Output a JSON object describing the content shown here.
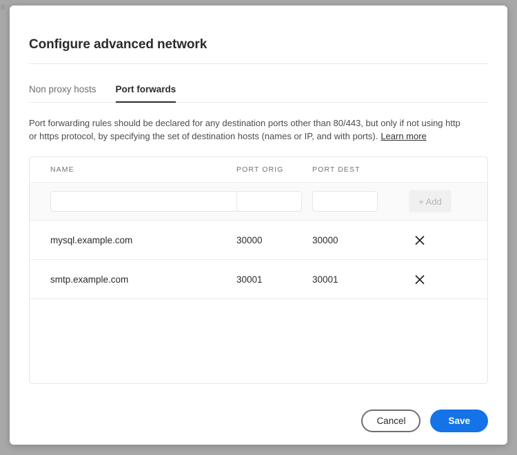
{
  "backdrop": {
    "clipped_text": "ri"
  },
  "dialog": {
    "title": "Configure advanced network",
    "tabs": [
      {
        "label": "Non proxy hosts",
        "active": false
      },
      {
        "label": "Port forwards",
        "active": true
      }
    ],
    "description": {
      "text": "Port forwarding rules should be declared for any destination ports other than 80/443, but only if not using http or https protocol, by specifying the set of destination hosts (names or IP, and with ports).",
      "link_label": "Learn more"
    },
    "table": {
      "columns": [
        "NAME",
        "PORT ORIG",
        "PORT DEST"
      ],
      "add_row": {
        "name_value": "",
        "name_placeholder": "",
        "port_orig_value": "",
        "port_orig_placeholder": "",
        "port_dest_value": "",
        "port_dest_placeholder": "",
        "add_label": "+ Add"
      },
      "rows": [
        {
          "name": "mysql.example.com",
          "port_orig": "30000",
          "port_dest": "30000",
          "delete_icon": "close-icon"
        },
        {
          "name": "smtp.example.com",
          "port_orig": "30001",
          "port_dest": "30001",
          "delete_icon": "close-icon"
        }
      ]
    },
    "footer": {
      "cancel_label": "Cancel",
      "save_label": "Save"
    }
  },
  "colors": {
    "accent": "#1473e6",
    "backdrop": "#a8a8a8",
    "text_primary": "#2b2b2b",
    "text_secondary": "#6e6e6e",
    "border": "#e4e4e4"
  }
}
